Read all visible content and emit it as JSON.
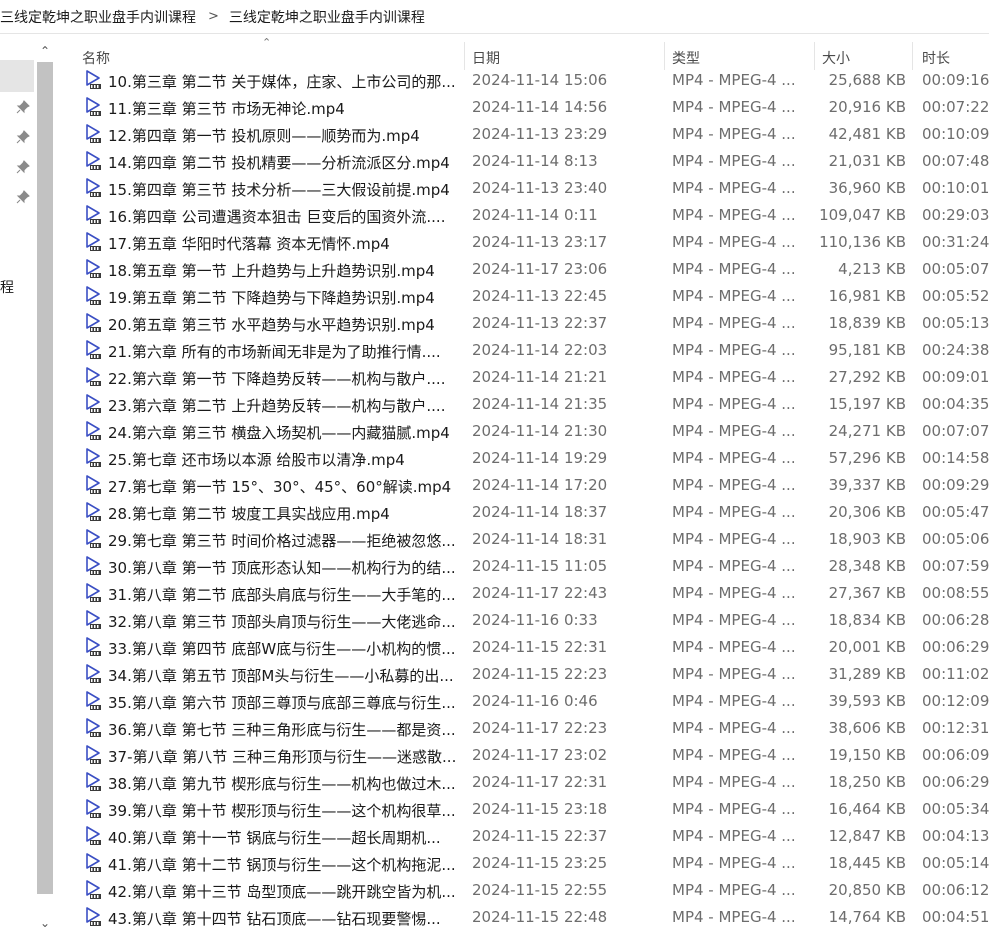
{
  "breadcrumb": [
    "三线定乾坤之职业盘手内训课程",
    "三线定乾坤之职业盘手内训课程"
  ],
  "nav": {
    "fragment": "程"
  },
  "columns": {
    "name": "名称",
    "date": "日期",
    "type": "类型",
    "size": "大小",
    "duration": "时长"
  },
  "files": [
    {
      "name": "10.第三章 第二节 关于媒体，庄家、上市公司的那...",
      "date": "2024-11-14 15:06",
      "type": "MP4 - MPEG-4 ...",
      "size": "25,688 KB",
      "duration": "00:09:16"
    },
    {
      "name": "11.第三章 第三节 市场无神论.mp4",
      "date": "2024-11-14 14:56",
      "type": "MP4 - MPEG-4 ...",
      "size": "20,916 KB",
      "duration": "00:07:22"
    },
    {
      "name": "12.第四章 第一节 投机原则——顺势而为.mp4",
      "date": "2024-11-13 23:29",
      "type": "MP4 - MPEG-4 ...",
      "size": "42,481 KB",
      "duration": "00:10:09"
    },
    {
      "name": "14.第四章 第二节 投机精要——分析流派区分.mp4",
      "date": "2024-11-14 8:13",
      "type": "MP4 - MPEG-4 ...",
      "size": "21,031 KB",
      "duration": "00:07:48"
    },
    {
      "name": "15.第四章 第三节 技术分析——三大假设前提.mp4",
      "date": "2024-11-13 23:40",
      "type": "MP4 - MPEG-4 ...",
      "size": "36,960 KB",
      "duration": "00:10:01"
    },
    {
      "name": "16.第四章 公司遭遇资本狙击 巨变后的国资外流....",
      "date": "2024-11-14 0:11",
      "type": "MP4 - MPEG-4 ...",
      "size": "109,047 KB",
      "duration": "00:29:03"
    },
    {
      "name": "17.第五章 华阳时代落幕 资本无情怀.mp4",
      "date": "2024-11-13 23:17",
      "type": "MP4 - MPEG-4 ...",
      "size": "110,136 KB",
      "duration": "00:31:24"
    },
    {
      "name": "18.第五章 第一节 上升趋势与上升趋势识别.mp4",
      "date": "2024-11-17 23:06",
      "type": "MP4 - MPEG-4 ...",
      "size": "4,213 KB",
      "duration": "00:05:07"
    },
    {
      "name": "19.第五章 第二节 下降趋势与下降趋势识别.mp4",
      "date": "2024-11-13 22:45",
      "type": "MP4 - MPEG-4 ...",
      "size": "16,981 KB",
      "duration": "00:05:52"
    },
    {
      "name": "20.第五章 第三节 水平趋势与水平趋势识别.mp4",
      "date": "2024-11-13 22:37",
      "type": "MP4 - MPEG-4 ...",
      "size": "18,839 KB",
      "duration": "00:05:13"
    },
    {
      "name": "21.第六章 所有的市场新闻无非是为了助推行情....",
      "date": "2024-11-14 22:03",
      "type": "MP4 - MPEG-4 ...",
      "size": "95,181 KB",
      "duration": "00:24:38"
    },
    {
      "name": "22.第六章 第一节 下降趋势反转——机构与散户....",
      "date": "2024-11-14 21:21",
      "type": "MP4 - MPEG-4 ...",
      "size": "27,292 KB",
      "duration": "00:09:01"
    },
    {
      "name": "23.第六章 第二节 上升趋势反转——机构与散户....",
      "date": "2024-11-14 21:35",
      "type": "MP4 - MPEG-4 ...",
      "size": "15,197 KB",
      "duration": "00:04:35"
    },
    {
      "name": "24.第六章 第三节 横盘入场契机——内藏猫腻.mp4",
      "date": "2024-11-14 21:30",
      "type": "MP4 - MPEG-4 ...",
      "size": "24,271 KB",
      "duration": "00:07:07"
    },
    {
      "name": "25.第七章 还市场以本源 给股市以清净.mp4",
      "date": "2024-11-14 19:29",
      "type": "MP4 - MPEG-4 ...",
      "size": "57,296 KB",
      "duration": "00:14:58"
    },
    {
      "name": "27.第七章 第一节 15°、30°、45°、60°解读.mp4",
      "date": "2024-11-14 17:20",
      "type": "MP4 - MPEG-4 ...",
      "size": "39,337 KB",
      "duration": "00:09:29"
    },
    {
      "name": "28.第七章 第二节 坡度工具实战应用.mp4",
      "date": "2024-11-14 18:37",
      "type": "MP4 - MPEG-4 ...",
      "size": "20,306 KB",
      "duration": "00:05:47"
    },
    {
      "name": "29.第七章 第三节 时间价格过滤器——拒绝被忽悠...",
      "date": "2024-11-14 18:31",
      "type": "MP4 - MPEG-4 ...",
      "size": "18,903 KB",
      "duration": "00:05:06"
    },
    {
      "name": "30.第八章 第一节 顶底形态认知——机构行为的结...",
      "date": "2024-11-15 11:05",
      "type": "MP4 - MPEG-4 ...",
      "size": "28,348 KB",
      "duration": "00:07:59"
    },
    {
      "name": "31.第八章 第二节 底部头肩底与衍生——大手笔的...",
      "date": "2024-11-17 22:43",
      "type": "MP4 - MPEG-4 ...",
      "size": "27,367 KB",
      "duration": "00:08:55"
    },
    {
      "name": "32.第八章 第三节 顶部头肩顶与衍生——大佬逃命...",
      "date": "2024-11-16 0:33",
      "type": "MP4 - MPEG-4 ...",
      "size": "18,834 KB",
      "duration": "00:06:28"
    },
    {
      "name": "33.第八章 第四节 底部W底与衍生——小机构的惯...",
      "date": "2024-11-15 22:31",
      "type": "MP4 - MPEG-4 ...",
      "size": "20,001 KB",
      "duration": "00:06:29"
    },
    {
      "name": "34.第八章 第五节 顶部M头与衍生——小私募的出...",
      "date": "2024-11-15 22:23",
      "type": "MP4 - MPEG-4 ...",
      "size": "31,289 KB",
      "duration": "00:11:02"
    },
    {
      "name": "35.第八章 第六节 顶部三尊顶与底部三尊底与衍生...",
      "date": "2024-11-16 0:46",
      "type": "MP4 - MPEG-4 ...",
      "size": "39,593 KB",
      "duration": "00:12:09"
    },
    {
      "name": "36.第八章 第七节 三种三角形底与衍生——都是资...",
      "date": "2024-11-17 22:23",
      "type": "MP4 - MPEG-4 ...",
      "size": "38,606 KB",
      "duration": "00:12:31"
    },
    {
      "name": "37-第八章 第八节 三种三角形顶与衍生——迷惑散...",
      "date": "2024-11-17 23:02",
      "type": "MP4 - MPEG-4 ...",
      "size": "19,150 KB",
      "duration": "00:06:09"
    },
    {
      "name": "38.第八章 第九节 楔形底与衍生——机构也做过木...",
      "date": "2024-11-17 22:31",
      "type": "MP4 - MPEG-4 ...",
      "size": "18,250 KB",
      "duration": "00:06:29"
    },
    {
      "name": "39.第八章 第十节 楔形顶与衍生——这个机构很草...",
      "date": "2024-11-15 23:18",
      "type": "MP4 - MPEG-4 ...",
      "size": "16,464 KB",
      "duration": "00:05:34"
    },
    {
      "name": "40.第八章 第十一节 锅底与衍生——超长周期机...",
      "date": "2024-11-15 22:37",
      "type": "MP4 - MPEG-4 ...",
      "size": "12,847 KB",
      "duration": "00:04:13"
    },
    {
      "name": "41.第八章 第十二节 锅顶与衍生——这个机构拖泥...",
      "date": "2024-11-15 23:25",
      "type": "MP4 - MPEG-4 ...",
      "size": "18,445 KB",
      "duration": "00:05:14"
    },
    {
      "name": "42.第八章 第十三节 岛型顶底——跳开跳空皆为机...",
      "date": "2024-11-15 22:55",
      "type": "MP4 - MPEG-4 ...",
      "size": "20,850 KB",
      "duration": "00:06:12"
    },
    {
      "name": "43.第八章 第十四节 钻石顶底——钻石现要警惕...",
      "date": "2024-11-15 22:48",
      "type": "MP4 - MPEG-4 ...",
      "size": "14,764 KB",
      "duration": "00:04:51"
    }
  ]
}
